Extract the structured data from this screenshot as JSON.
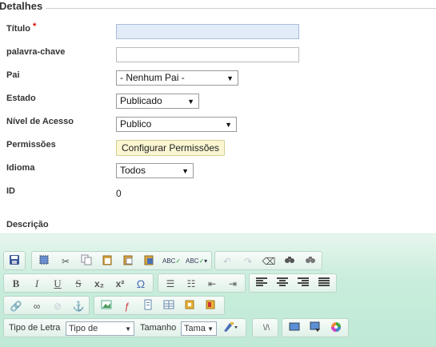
{
  "form": {
    "legend": "Detalhes",
    "title_label": "Título",
    "required_marker": "*",
    "title_value": "",
    "keyword_label": "palavra-chave",
    "keyword_value": "",
    "parent_label": "Pai",
    "parent_value": "- Nenhum Pai -",
    "state_label": "Estado",
    "state_value": "Publicado",
    "access_label": "Nível de Acesso",
    "access_value": "Publico",
    "permissions_label": "Permissões",
    "permissions_button": "Configurar Permissões",
    "language_label": "Idioma",
    "language_value": "Todos",
    "id_label": "ID",
    "id_value": "0",
    "description_label": "Descrição"
  },
  "editor": {
    "font_label": "Tipo de Letra",
    "font_select": "Tipo de",
    "size_label": "Tamanho",
    "size_select": "Tama",
    "icons": {
      "bold": "B",
      "italic": "I",
      "underline": "U",
      "strike": "S",
      "subscript": "x₂",
      "superscript": "x²",
      "omega": "Ω"
    }
  },
  "colors": {
    "required": "#dd0000",
    "editor_bg": "#c9eddc",
    "focus_field": "#e1ecf8",
    "button_bg": "#fbf6d2"
  }
}
